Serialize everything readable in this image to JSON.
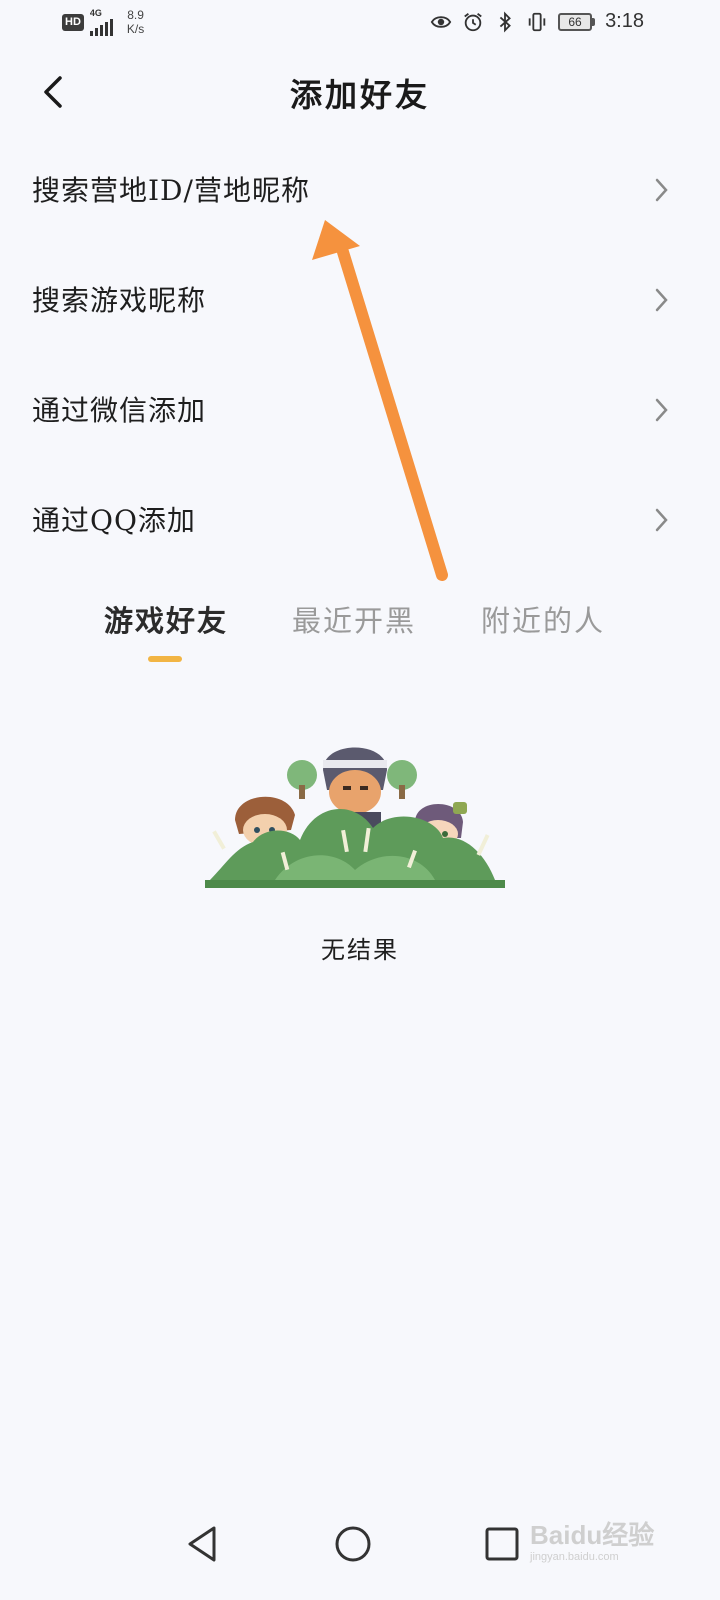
{
  "status_bar": {
    "hd": "HD",
    "network": "4G",
    "speed_value": "8.9",
    "speed_unit": "K/s",
    "battery": "66",
    "time": "3:18",
    "icons": [
      "eye-icon",
      "alarm-icon",
      "bluetooth-icon",
      "vibrate-icon"
    ]
  },
  "header": {
    "title": "添加好友"
  },
  "menu": {
    "items": [
      {
        "label": "搜索营地ID/营地昵称"
      },
      {
        "label": "搜索游戏昵称"
      },
      {
        "label": "通过微信添加"
      },
      {
        "label": "通过QQ添加"
      }
    ]
  },
  "tabs": {
    "items": [
      {
        "label": "游戏好友",
        "active": true
      },
      {
        "label": "最近开黑",
        "active": false
      },
      {
        "label": "附近的人",
        "active": false
      }
    ],
    "accent_color": "#f2b544"
  },
  "empty_state": {
    "text": "无结果"
  },
  "annotation": {
    "arrow_color": "#f5923e"
  },
  "watermark": {
    "brand": "Baidu经验",
    "sub": "jingyan.baidu.com"
  }
}
